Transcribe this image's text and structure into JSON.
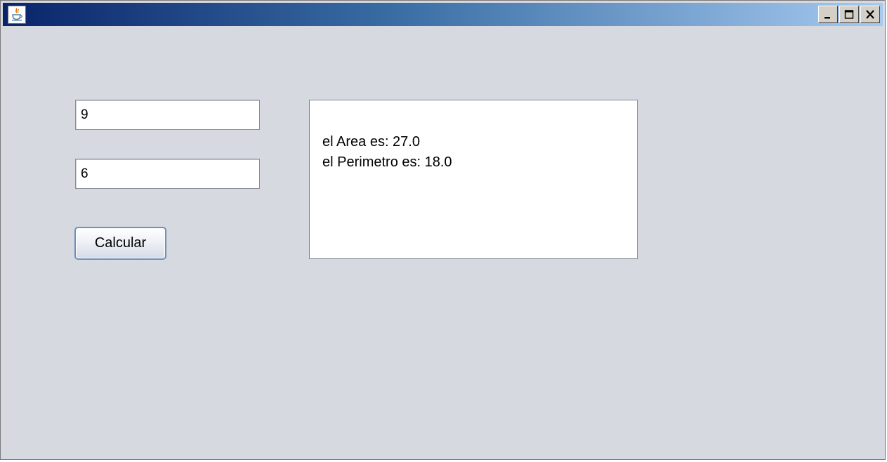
{
  "window": {
    "title": "",
    "icon": "java-coffee-cup-icon",
    "controls": [
      "minimize-icon",
      "maximize-icon",
      "close-icon"
    ]
  },
  "form": {
    "input_1": {
      "value": "9"
    },
    "input_2": {
      "value": "6"
    },
    "calculate_label": "Calcular"
  },
  "output": {
    "lines": [
      "el Area es: 27.0",
      "el Perimetro es: 18.0"
    ]
  },
  "colors": {
    "title_gradient_start": "#0a246a",
    "title_gradient_end": "#a6caf0",
    "background": "#d6d9e0"
  }
}
